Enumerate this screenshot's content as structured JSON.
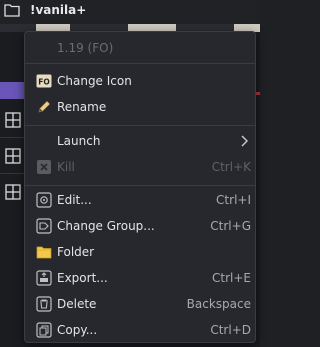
{
  "background": {
    "title": "!vanila+"
  },
  "menu": {
    "header": "1.19 (FO)",
    "items": [
      {
        "label": "Change Icon",
        "shortcut": "",
        "icon": "fo-badge-icon"
      },
      {
        "label": "Rename",
        "shortcut": "",
        "icon": "pencil-icon"
      },
      {
        "label": "Launch",
        "shortcut": "",
        "icon": "chevron-right-icon"
      },
      {
        "label": "Kill",
        "shortcut": "Ctrl+K",
        "icon": "kill-x-icon",
        "disabled": true
      },
      {
        "label": "Edit...",
        "shortcut": "Ctrl+I",
        "icon": "gear-icon"
      },
      {
        "label": "Change Group...",
        "shortcut": "Ctrl+G",
        "icon": "tag-icon"
      },
      {
        "label": "Folder",
        "shortcut": "",
        "icon": "folder-icon"
      },
      {
        "label": "Export...",
        "shortcut": "Ctrl+E",
        "icon": "export-icon"
      },
      {
        "label": "Delete",
        "shortcut": "Backspace",
        "icon": "trash-icon"
      },
      {
        "label": "Copy...",
        "shortcut": "Ctrl+D",
        "icon": "copy-icon"
      }
    ]
  },
  "colors": {
    "menu_bg": "#27282d",
    "text": "#e4e4e6",
    "disabled_text": "#5f6166",
    "accent_purple": "#6a55b8"
  }
}
